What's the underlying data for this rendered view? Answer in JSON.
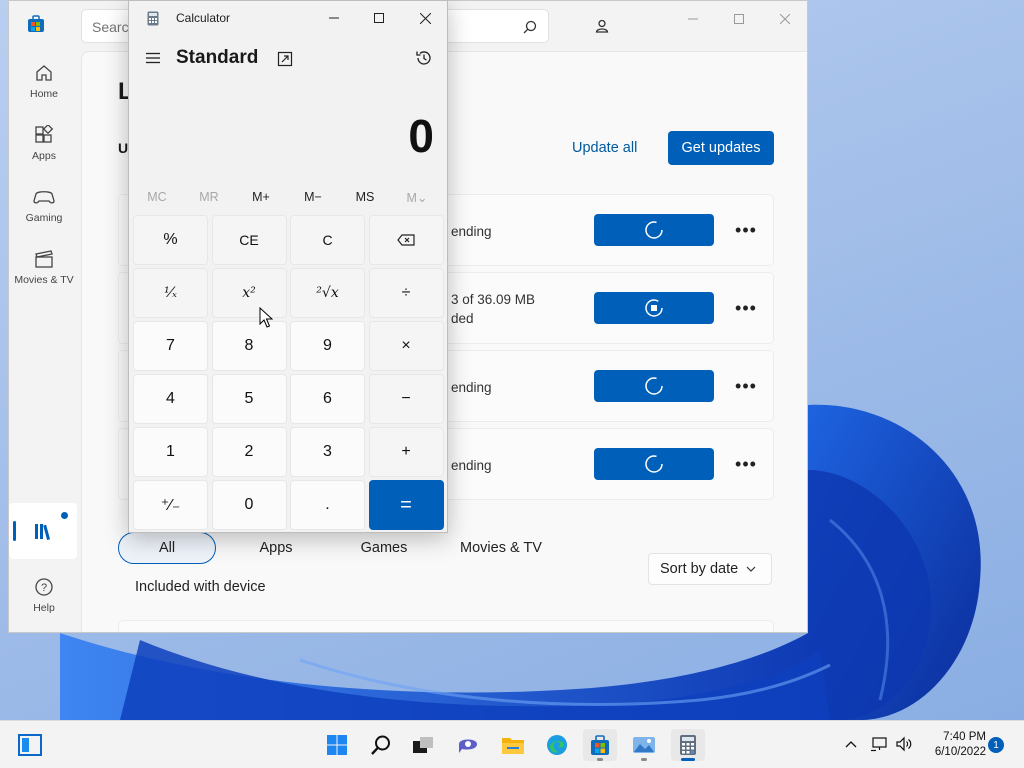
{
  "store": {
    "search_placeholder": "Search apps, games, movies and more",
    "nav": [
      {
        "label": "Home",
        "icon": "home-icon"
      },
      {
        "label": "Apps",
        "icon": "apps-icon"
      },
      {
        "label": "Gaming",
        "icon": "gaming-icon"
      },
      {
        "label": "Movies & TV",
        "icon": "movies-icon"
      },
      {
        "label": "Help",
        "icon": "help-icon"
      }
    ],
    "page_title": "L",
    "section_title": "U",
    "update_all": "Update all",
    "get_updates": "Get updates",
    "downloads": [
      {
        "status_line1": "ending",
        "status_line2": "",
        "state": "spinner"
      },
      {
        "status_line1": "3 of 36.09 MB",
        "status_line2": "ded",
        "state": "stop"
      },
      {
        "status_line1": "ending",
        "status_line2": "",
        "state": "spinner"
      },
      {
        "status_line1": "ending",
        "status_line2": "",
        "state": "spinner"
      }
    ],
    "more_label": "•••",
    "filters": [
      "All",
      "Apps",
      "Games",
      "Movies & TV"
    ],
    "active_filter": "All",
    "sort_label": "Sort by date",
    "included_label": "Included with device",
    "accent": "#005fb8"
  },
  "calculator": {
    "window_title": "Calculator",
    "mode": "Standard",
    "display": "0",
    "memory": [
      {
        "label": "MC",
        "enabled": false
      },
      {
        "label": "MR",
        "enabled": false
      },
      {
        "label": "M+",
        "enabled": true
      },
      {
        "label": "M−",
        "enabled": true
      },
      {
        "label": "MS",
        "enabled": true
      },
      {
        "label": "M⌄",
        "enabled": false
      }
    ],
    "keys": [
      [
        "%",
        "CE",
        "C",
        "⌫"
      ],
      [
        "¹⁄ₓ",
        "x²",
        "²√x",
        "÷"
      ],
      [
        "7",
        "8",
        "9",
        "×"
      ],
      [
        "4",
        "5",
        "6",
        "−"
      ],
      [
        "1",
        "2",
        "3",
        "+"
      ],
      [
        "⁺⁄₋",
        "0",
        ".",
        "="
      ]
    ]
  },
  "taskbar": {
    "clock_time": "7:40 PM",
    "clock_date": "6/10/2022",
    "notification_count": "1",
    "apps": [
      "start",
      "search",
      "task-view",
      "chat",
      "file-explorer",
      "edge",
      "store",
      "photos",
      "calculator"
    ]
  }
}
